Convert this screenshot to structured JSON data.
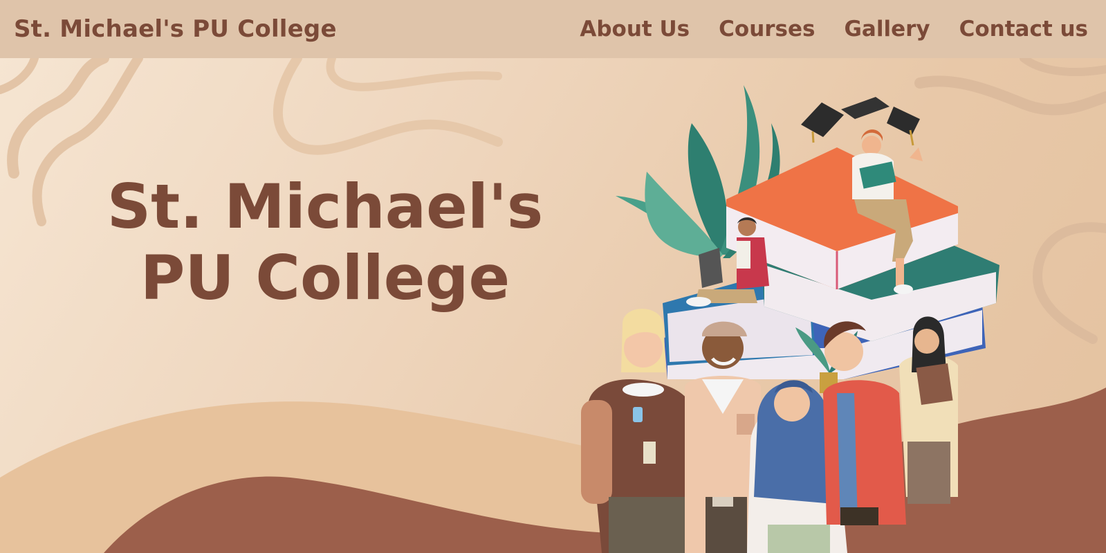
{
  "header": {
    "brand": "St. Michael's PU College",
    "nav": [
      {
        "label": "About Us"
      },
      {
        "label": "Courses"
      },
      {
        "label": "Gallery"
      },
      {
        "label": "Contact us"
      }
    ]
  },
  "hero": {
    "title_line1": "St. Michael's",
    "title_line2": "PU College"
  },
  "illustration": {
    "icon": "students-with-books-illustration"
  },
  "colors": {
    "brand_text": "#7b4a38",
    "navbar_bg": "#dfc4aa",
    "page_bg": "#efd7bf",
    "wave_dark": "#9c5f4b",
    "wave_light": "#e7c29c"
  }
}
